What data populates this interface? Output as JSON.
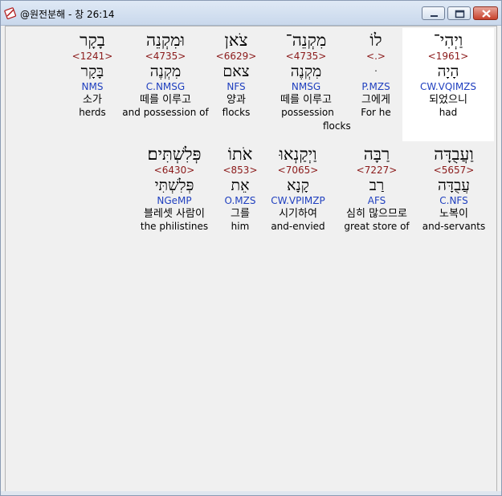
{
  "window": {
    "title": "@원전분해 - 창 26:14"
  },
  "rows": [
    [
      {
        "heb": "וַיְהִי־",
        "strong": "<1961>",
        "lemma": "הָיָה",
        "morph": "CW.VQIMZS",
        "kor": "되었으니",
        "eng": "had"
      },
      {
        "heb": "לוֹ",
        "strong": "<.>",
        "lemma": "ּ",
        "morph": "P.MZS",
        "kor": "그에게",
        "eng": "For he"
      },
      {
        "heb": "מִקְנֵה־",
        "strong": "<4735>",
        "lemma": "מִקְנֶה",
        "morph": "NMSG",
        "kor": "떼를 이루고",
        "eng": "possession"
      },
      {
        "heb": "צֹאן",
        "strong": "<6629>",
        "lemma": "צאם",
        "morph": "NFS",
        "kor": "양과",
        "eng": "flocks"
      },
      {
        "heb": "וּמִקְנֵה",
        "strong": "<4735>",
        "lemma": "מִקְנֶה",
        "morph": "C.NMSG",
        "kor": "떼를 이루고",
        "eng": "and possession of"
      },
      {
        "heb": "בָקָר",
        "strong": "<1241>",
        "lemma": "בָּקָר",
        "morph": "NMS",
        "kor": "소가",
        "eng": "herds"
      }
    ],
    [
      {
        "heb": "וַעֲבֻדָּה",
        "strong": "<5657>",
        "lemma": "עֲבֻדָּה",
        "morph": "C.NFS",
        "kor": "노복이",
        "eng": "and-servants"
      },
      {
        "heb": "רַבָּה",
        "strong": "<7227>",
        "lemma": "רַב",
        "morph": "AFS",
        "kor": "심히 많으므로",
        "eng": "great store of"
      },
      {
        "heb": "וַיְקַנְאוּ",
        "strong": "<7065>",
        "lemma": "קָנָא",
        "morph": "CW.VPIMZP",
        "kor": "시기하여",
        "eng": "and-envied"
      },
      {
        "heb": "אֹתוֹ",
        "strong": "<853>",
        "lemma": "אֵת",
        "morph": "O.MZS",
        "kor": "그를",
        "eng": "him"
      },
      {
        "heb": "פְּלִשְׁתִּים׃",
        "strong": "<6430>",
        "lemma": "פְּלִשְׁתִּי",
        "morph": "NGeMP",
        "kor": "블레셋 사람이",
        "eng": "the philistines"
      }
    ]
  ],
  "extra": {
    "flocks_tag": "flocks"
  }
}
